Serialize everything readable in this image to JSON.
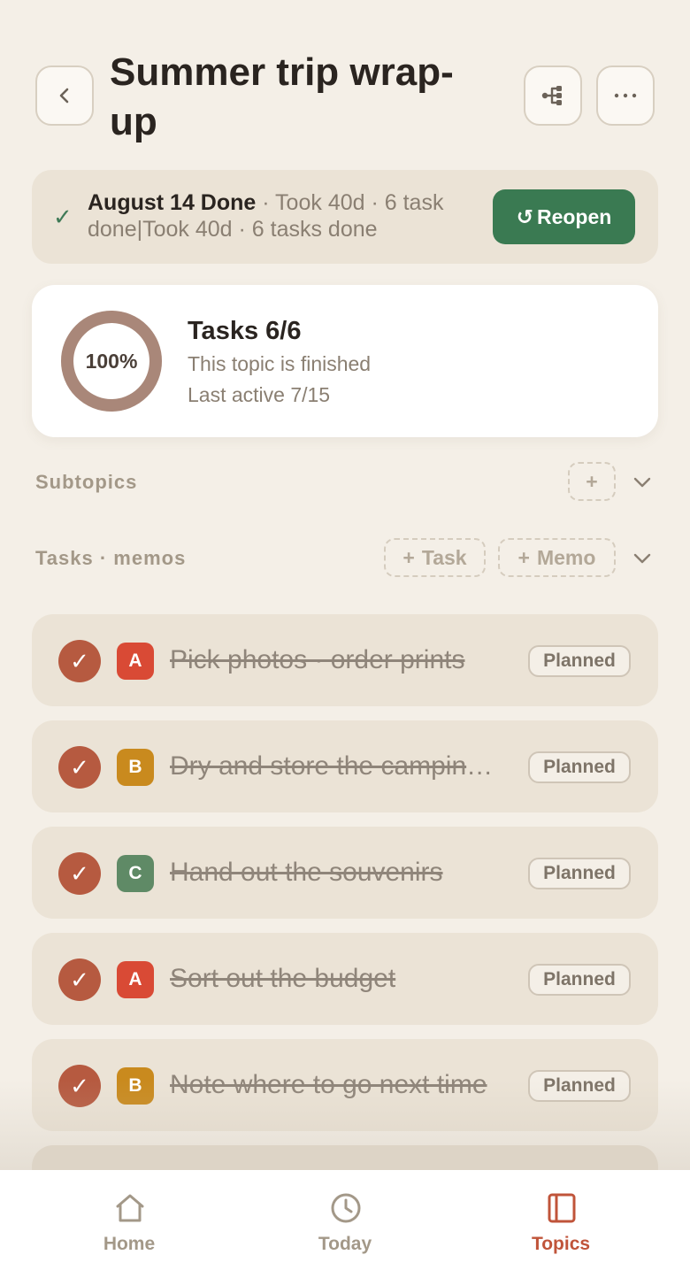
{
  "header": {
    "title": "Summer trip wrap-up"
  },
  "banner": {
    "check": "✓",
    "done_label": "August 14 Done",
    "detail": " · Took 40d · 6 task done|Took 40d · 6 tasks done",
    "reopen_icon": "↺",
    "reopen_label": "Reopen"
  },
  "progress": {
    "percent_label": "100%",
    "percent": 100,
    "title": "Tasks 6/6",
    "status": "This topic is finished",
    "last_active": "Last active 7/15"
  },
  "subtopics": {
    "label": "Subtopics",
    "add": "+"
  },
  "tasks_section": {
    "label": "Tasks · memos",
    "add_task_plus": "+",
    "add_task": "Task",
    "add_memo_plus": "+",
    "add_memo": "Memo"
  },
  "tasks": [
    {
      "priority": "A",
      "priority_color": "#d94a35",
      "title": "Pick photos · order prints",
      "status": "Planned"
    },
    {
      "priority": "B",
      "priority_color": "#c98a1e",
      "title": "Dry and store the camping gear",
      "status": "Planned"
    },
    {
      "priority": "C",
      "priority_color": "#5f8a66",
      "title": "Hand out the souvenirs",
      "status": "Planned"
    },
    {
      "priority": "A",
      "priority_color": "#d94a35",
      "title": "Sort out the budget",
      "status": "Planned"
    },
    {
      "priority": "B",
      "priority_color": "#c98a1e",
      "title": "Note where to go next time",
      "status": "Planned"
    }
  ],
  "nav": {
    "home": "Home",
    "today": "Today",
    "topics": "Topics"
  },
  "colors": {
    "accent_green": "#3a7a52",
    "done_red": "#b65a40",
    "active_tab": "#c0543a",
    "inactive_tab": "#a39888"
  }
}
